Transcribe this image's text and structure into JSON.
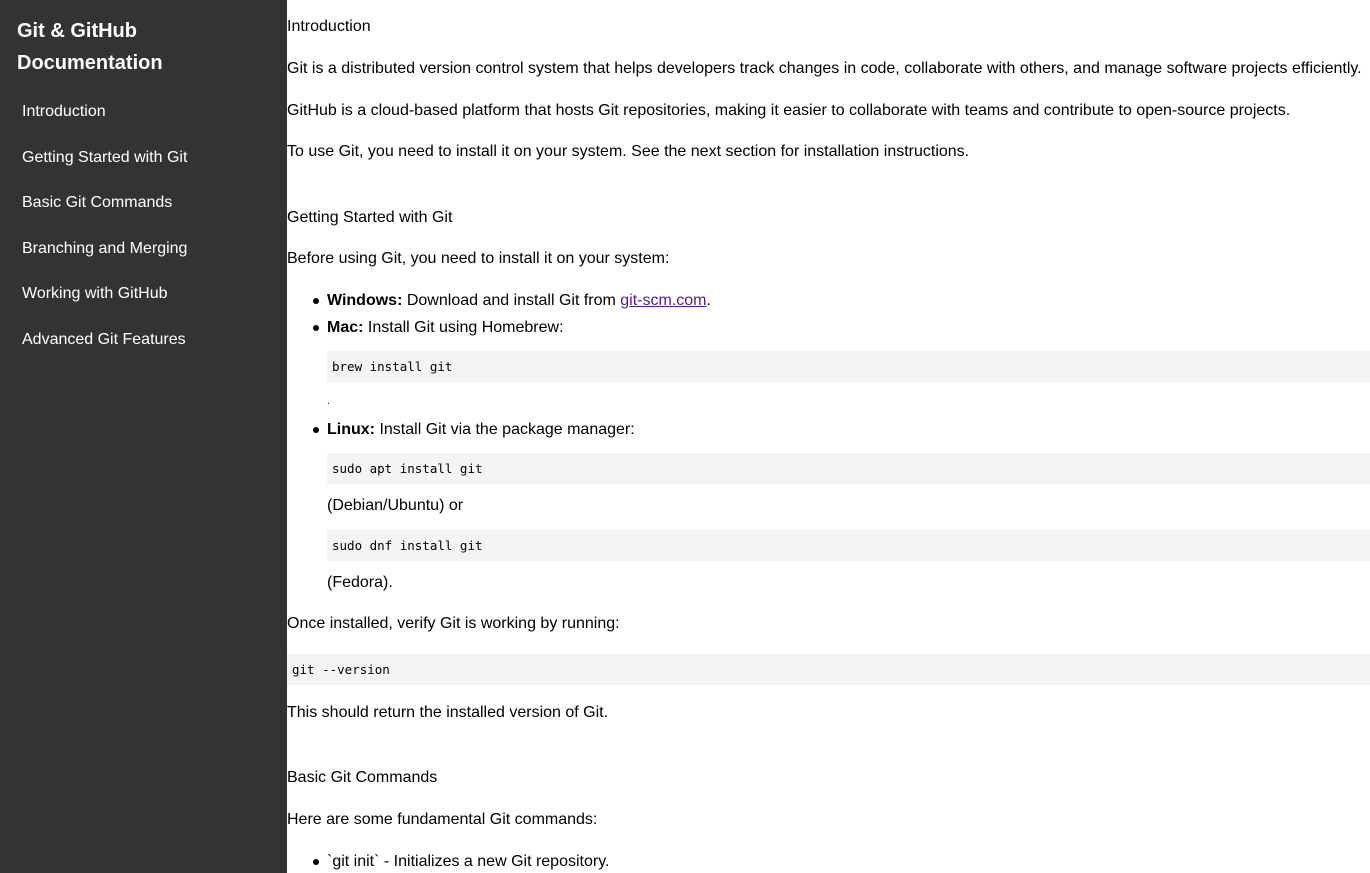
{
  "sidebar": {
    "title": "Git & GitHub Documentation",
    "items": [
      {
        "label": "Introduction"
      },
      {
        "label": "Getting Started with Git"
      },
      {
        "label": "Basic Git Commands"
      },
      {
        "label": "Branching and Merging"
      },
      {
        "label": "Working with GitHub"
      },
      {
        "label": "Advanced Git Features"
      }
    ]
  },
  "intro": {
    "heading": "Introduction",
    "p1": "Git is a distributed version control system that helps developers track changes in code, collaborate with others, and manage software projects efficiently.",
    "p2": "GitHub is a cloud-based platform that hosts Git repositories, making it easier to collaborate with teams and contribute to open-source projects.",
    "p3": "To use Git, you need to install it on your system. See the next section for installation instructions."
  },
  "getting_started": {
    "heading": "Getting Started with Git",
    "lead": "Before using Git, you need to install it on your system:",
    "windows_label": "Windows:",
    "windows_text": " Download and install Git from ",
    "windows_link": "git-scm.com",
    "windows_end": ".",
    "mac_label": "Mac:",
    "mac_text": " Install Git using Homebrew:",
    "mac_code": "brew install git",
    "mac_end": ".",
    "linux_label": "Linux:",
    "linux_text": " Install Git via the package manager:",
    "linux_code1": "sudo apt install git",
    "linux_note1": "(Debian/Ubuntu) or",
    "linux_code2": "sudo dnf install git",
    "linux_note2": "(Fedora).",
    "verify": "Once installed, verify Git is working by running:",
    "verify_code": "git --version",
    "verify_after": "This should return the installed version of Git."
  },
  "basic_commands": {
    "heading": "Basic Git Commands",
    "lead": "Here are some fundamental Git commands:",
    "items": [
      "`git init` - Initializes a new Git repository."
    ]
  },
  "colors": {
    "sidebar_bg": "#333333",
    "code_bg": "#f4f4f4",
    "link": "#551a8b"
  }
}
